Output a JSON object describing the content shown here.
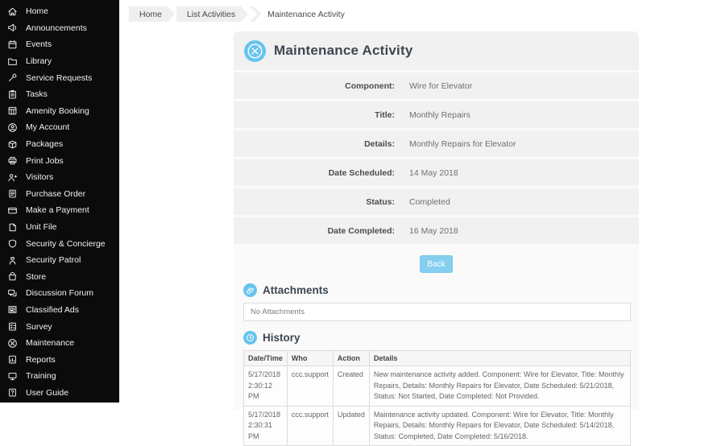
{
  "sidebar": {
    "items": [
      {
        "label": "Home",
        "icon": "home-icon"
      },
      {
        "label": "Announcements",
        "icon": "megaphone-icon"
      },
      {
        "label": "Events",
        "icon": "calendar-icon"
      },
      {
        "label": "Library",
        "icon": "folder-icon"
      },
      {
        "label": "Service Requests",
        "icon": "wrench-icon"
      },
      {
        "label": "Tasks",
        "icon": "clipboard-icon"
      },
      {
        "label": "Amenity Booking",
        "icon": "calendar-grid-icon"
      },
      {
        "label": "My Account",
        "icon": "person-circle-icon"
      },
      {
        "label": "Packages",
        "icon": "box-icon"
      },
      {
        "label": "Print Jobs",
        "icon": "printer-icon"
      },
      {
        "label": "Visitors",
        "icon": "person-plus-icon"
      },
      {
        "label": "Purchase Order",
        "icon": "document-icon"
      },
      {
        "label": "Make a Payment",
        "icon": "credit-card-icon"
      },
      {
        "label": "Unit File",
        "icon": "file-icon"
      },
      {
        "label": "Security & Concierge",
        "icon": "shield-icon"
      },
      {
        "label": "Security Patrol",
        "icon": "guard-icon"
      },
      {
        "label": "Store",
        "icon": "shopping-bag-icon"
      },
      {
        "label": "Discussion Forum",
        "icon": "chat-bubbles-icon"
      },
      {
        "label": "Classified Ads",
        "icon": "newspaper-icon"
      },
      {
        "label": "Survey",
        "icon": "survey-icon"
      },
      {
        "label": "Maintenance",
        "icon": "tools-icon"
      },
      {
        "label": "Reports",
        "icon": "report-chart-icon"
      },
      {
        "label": "Training",
        "icon": "monitor-icon"
      },
      {
        "label": "User Guide",
        "icon": "book-help-icon"
      }
    ]
  },
  "breadcrumb": {
    "items": [
      "Home",
      "List Activities",
      "Maintenance Activity"
    ]
  },
  "page": {
    "title": "Maintenance Activity",
    "icon": "maintenance-tools-icon",
    "fields": [
      {
        "label": "Component:",
        "value": "Wire for Elevator"
      },
      {
        "label": "Title:",
        "value": "Monthly Repairs"
      },
      {
        "label": "Details:",
        "value": "Monthly Repairs for Elevator"
      },
      {
        "label": "Date Scheduled:",
        "value": "14 May 2018"
      },
      {
        "label": "Status:",
        "value": "Completed"
      },
      {
        "label": "Date Completed:",
        "value": "16 May 2018"
      }
    ],
    "back_label": "Back"
  },
  "attachments": {
    "title": "Attachments",
    "icon": "paperclip-icon",
    "empty_text": "No Attachments"
  },
  "history": {
    "title": "History",
    "icon": "history-clock-icon",
    "columns": [
      "Date/Time",
      "Who",
      "Action",
      "Details"
    ],
    "rows": [
      {
        "datetime": "5/17/2018 2:30:12 PM",
        "who": "ccc.support",
        "action": "Created",
        "details": "New maintenance activity added. Component: Wire for Elevator, Title: Monthly Repairs, Details: Monthly Repairs for Elevator, Date Scheduled: 5/21/2018, Status: Not Started, Date Completed: Not Provided."
      },
      {
        "datetime": "5/17/2018 2:30:31 PM",
        "who": "ccc.support",
        "action": "Updated",
        "details": "Maintenance activity updated. Component: Wire for Elevator, Title: Monthly Repairs, Details: Monthly Repairs for Elevator, Date Scheduled: 5/14/2018, Status: Completed, Date Completed: 5/16/2018."
      }
    ]
  },
  "colors": {
    "accent_blue": "#67c4ee",
    "back_button": "#85ceef",
    "sidebar_bg": "#0b0b0b",
    "row_gray": "#f1f1f1"
  }
}
